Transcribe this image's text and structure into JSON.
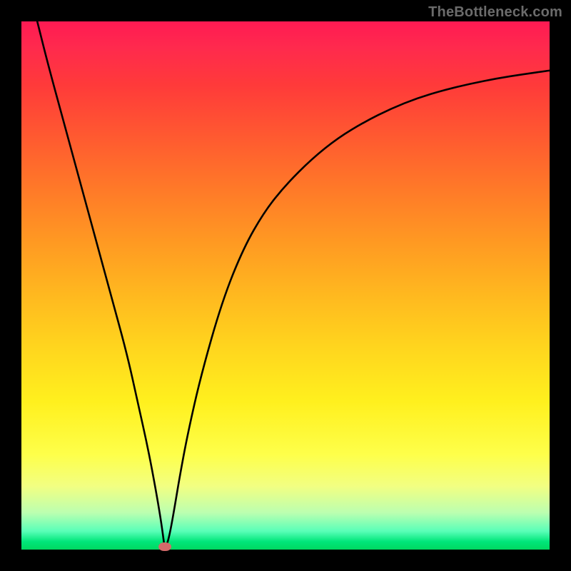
{
  "watermark": "TheBottleneck.com",
  "chart_data": {
    "type": "line",
    "title": "",
    "xlabel": "",
    "ylabel": "",
    "xlim": [
      0,
      100
    ],
    "ylim": [
      0,
      100
    ],
    "grid": false,
    "legend": false,
    "series": [
      {
        "name": "bottleneck-curve",
        "x": [
          3,
          5,
          8,
          11,
          14,
          17,
          20,
          22,
          24,
          25.5,
          26.5,
          27,
          27.1,
          27.6,
          28.2,
          29,
          30,
          31.5,
          34,
          38,
          42,
          46,
          50,
          55,
          60,
          65,
          70,
          75,
          80,
          85,
          90,
          95,
          100
        ],
        "values": [
          100,
          92,
          81,
          70,
          59,
          48,
          37,
          28,
          19,
          11,
          5,
          1.2,
          0.5,
          1.0,
          3.5,
          8,
          14,
          22,
          33,
          47,
          57,
          64,
          69,
          74,
          78,
          81,
          83.5,
          85.5,
          87,
          88.2,
          89.2,
          90,
          90.7
        ]
      }
    ],
    "marker": {
      "x": 27.1,
      "y": 0.5
    },
    "background_gradient": {
      "top": "#ff1a53",
      "bottom": "#00d860"
    }
  }
}
